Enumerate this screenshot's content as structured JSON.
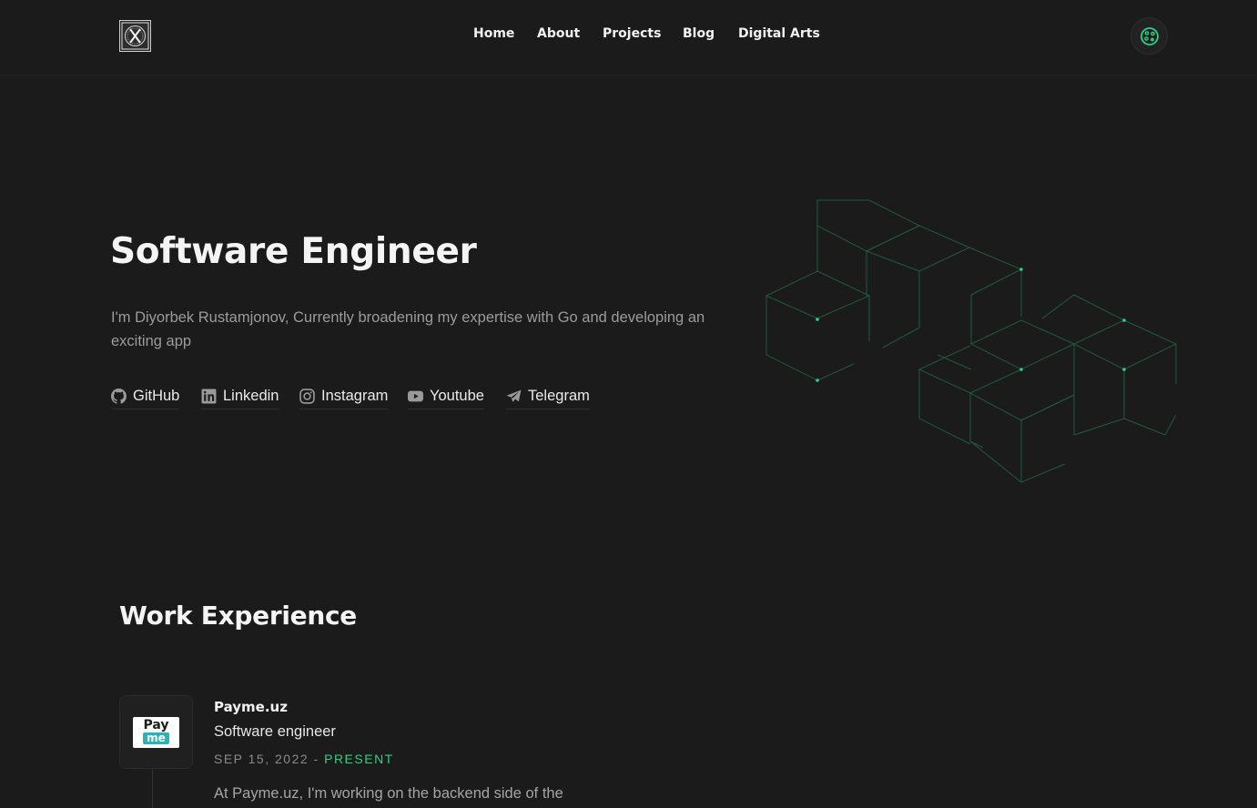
{
  "nav": {
    "links": [
      "Home",
      "About",
      "Projects",
      "Blog",
      "Digital Arts"
    ]
  },
  "hero": {
    "title": "Software Engineer",
    "description": "I'm Diyorbek Rustamjonov, Currently broadening my expertise with Go and developing an exciting app",
    "socials": [
      {
        "label": "GitHub",
        "icon": "github-icon"
      },
      {
        "label": "Linkedin",
        "icon": "linkedin-icon"
      },
      {
        "label": "Instagram",
        "icon": "instagram-icon"
      },
      {
        "label": "Youtube",
        "icon": "youtube-icon"
      },
      {
        "label": "Telegram",
        "icon": "telegram-icon"
      }
    ]
  },
  "work": {
    "title": "Work Experience",
    "items": [
      {
        "company": "Payme.uz",
        "logo_text_top": "Pay",
        "logo_text_bottom": "me",
        "role": "Software engineer",
        "start": "SEP 15, 2022",
        "separator": " - ",
        "end": "PRESENT",
        "description": "At Payme.uz, I'm working on the backend side of the"
      }
    ]
  },
  "colors": {
    "background": "#1b1b1b",
    "accent": "#2fcf85",
    "muted_text": "#9b9b9b"
  }
}
